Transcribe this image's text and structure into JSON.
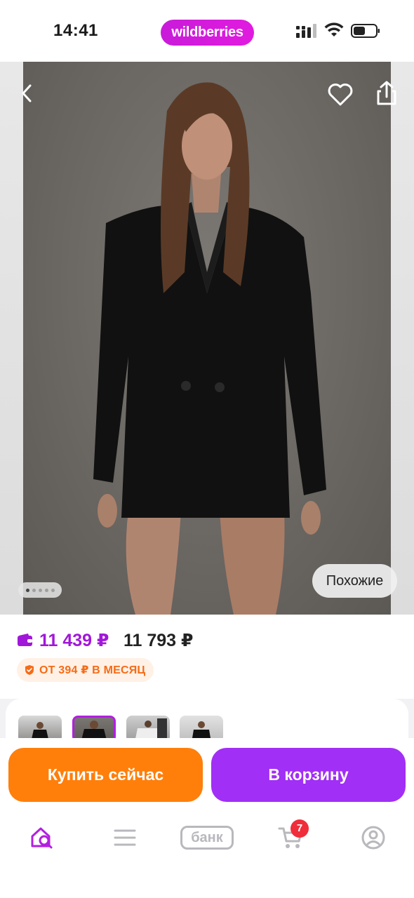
{
  "status_bar": {
    "time": "14:41",
    "brand": "wildberries"
  },
  "gallery": {
    "similar_label": "Похожие",
    "dots_total": 5,
    "dots_active": 1
  },
  "price": {
    "current": "11 439 ₽",
    "old": "11 793 ₽",
    "installment": "ОТ 394 ₽ В МЕСЯЦ",
    "accent_color": "#a117d9"
  },
  "thumbnails": {
    "count_visible": 4,
    "selected_index": 1
  },
  "actions": {
    "buy_now": "Купить сейчас",
    "add_to_cart": "В корзину",
    "buy_color": "#ff7f0a",
    "cart_color": "#a12ff5"
  },
  "bottom_nav": {
    "items": [
      {
        "name": "home-search",
        "icon": "home-search-icon"
      },
      {
        "name": "catalog",
        "icon": "menu-icon"
      },
      {
        "name": "bank",
        "icon": "bank-icon",
        "label": "банк"
      },
      {
        "name": "cart",
        "icon": "cart-icon",
        "badge": "7"
      },
      {
        "name": "profile",
        "icon": "profile-icon"
      }
    ]
  }
}
